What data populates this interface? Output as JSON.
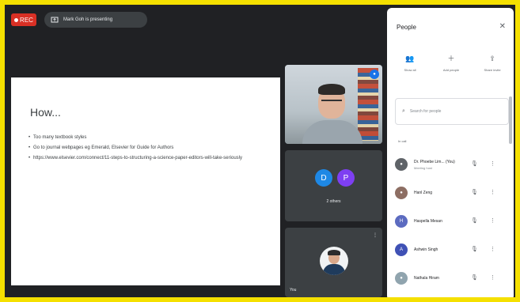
{
  "recording": {
    "label": "REC"
  },
  "presenting": {
    "text": "Mark Goh is presenting"
  },
  "slide": {
    "title": "How...",
    "bullets": [
      "Too many textbook styles",
      "Go to journal webpages eg Emerald, Elsevier for Guide for Authors",
      "https://www.elsevier.com/connect/11-steps-to-structuring-a-science-paper-editors-will-take-seriously"
    ]
  },
  "tiles": {
    "group_avatars": [
      "D",
      "P"
    ],
    "group_label": "2 others",
    "self_label": "You"
  },
  "panel": {
    "title": "People",
    "actions": [
      {
        "label": "Show all",
        "icon": "people-icon"
      },
      {
        "label": "Add people",
        "icon": "add-person-icon"
      },
      {
        "label": "Share invite",
        "icon": "share-icon"
      }
    ],
    "search_placeholder": "Search for people",
    "section_label": "In call",
    "people": [
      {
        "name": "Dr. Phoebe Lim... (You)",
        "sub": "Meeting host",
        "avatar": "photo",
        "color": "#5f6368"
      },
      {
        "name": "Hanl Zeng",
        "sub": "",
        "avatar": "photo",
        "color": "#8d6e63"
      },
      {
        "name": "Haspella Mesan",
        "sub": "",
        "avatar": "H",
        "color": "#5c6bc0"
      },
      {
        "name": "Ashwin Singh",
        "sub": "",
        "avatar": "A",
        "color": "#3f51b5"
      },
      {
        "name": "Nathala Hiram",
        "sub": "",
        "avatar": "photo",
        "color": "#90a4ae"
      }
    ]
  }
}
